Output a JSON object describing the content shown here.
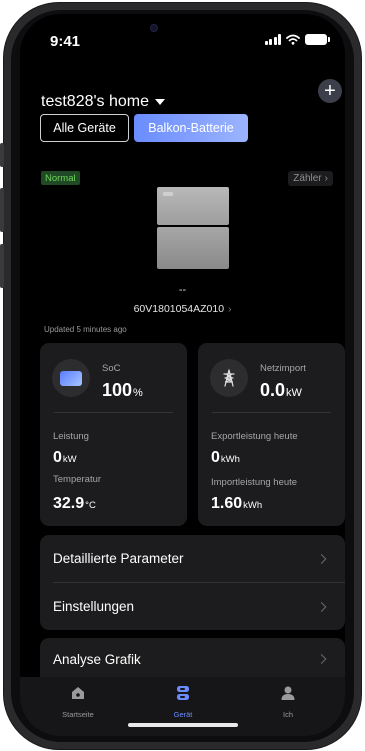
{
  "status_bar": {
    "time": "9:41"
  },
  "header": {
    "home_name": "test828's home",
    "add_label": "+"
  },
  "tabs": [
    {
      "label": "Alle Geräte",
      "active": false
    },
    {
      "label": "Balkon-Batterie",
      "active": true
    }
  ],
  "device": {
    "status_badge": "Normal",
    "meter_button": "Zähler",
    "name_placeholder": "--",
    "serial": "60V1801054AZ010",
    "updated": "Updated 5 minutes ago"
  },
  "card_battery": {
    "soc_label": "SoC",
    "soc_value": "100",
    "soc_unit": "%",
    "power_label": "Leistung",
    "power_value": "0",
    "power_unit": "kW",
    "temp_label": "Temperatur",
    "temp_value": "32.9",
    "temp_unit": "°C"
  },
  "card_grid": {
    "import_label": "Netzimport",
    "import_value": "0.0",
    "import_unit": "kW",
    "export_label": "Exportleistung heute",
    "export_value": "0",
    "export_unit": "kWh",
    "import_today_label": "Importleistung heute",
    "import_today_value": "1.60",
    "import_today_unit": "kWh"
  },
  "menu": [
    {
      "label": "Detaillierte Parameter"
    },
    {
      "label": "Einstellungen"
    },
    {
      "label": "Analyse Grafik"
    }
  ],
  "tabbar": [
    {
      "label": "Startseite",
      "icon": "home-icon",
      "active": false
    },
    {
      "label": "Gerät",
      "icon": "device-icon",
      "active": true
    },
    {
      "label": "Ich",
      "icon": "person-icon",
      "active": false
    }
  ],
  "colors": {
    "accent": "#6a8cff",
    "status_green": "#6ed35a",
    "card_bg": "#1c1c1e"
  }
}
